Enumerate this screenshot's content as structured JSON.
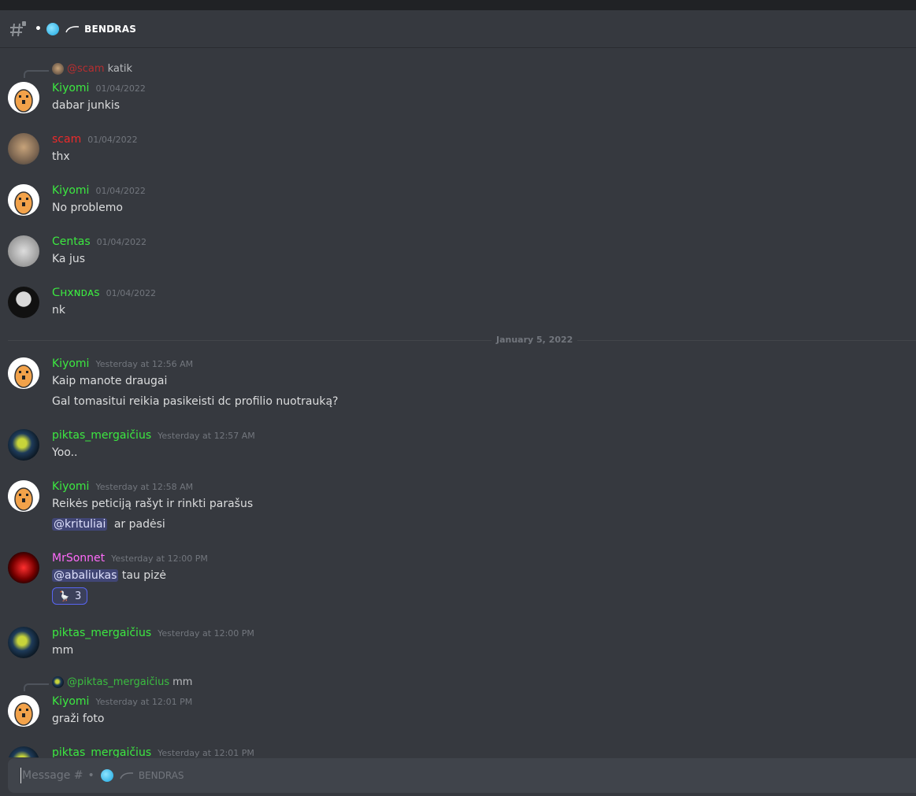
{
  "header": {
    "channel_dot": "•",
    "channel_name": "BENDRAS"
  },
  "colors": {
    "kiyomi": "#3ce840",
    "scam": "#ed2a2a",
    "centas": "#3ce840",
    "chx": "#3ce840",
    "pikt": "#3ce840",
    "mr": "#ff6bfa",
    "mention_bg": "#414675"
  },
  "messages": [
    {
      "reply_mention": "@scam",
      "reply_text": "katik",
      "user": "Kiyomi",
      "time": "01/04/2022",
      "lines": [
        "dabar junkis"
      ]
    },
    {
      "user": "scam",
      "time": "01/04/2022",
      "lines": [
        "thx"
      ]
    },
    {
      "user": "Kiyomi",
      "time": "01/04/2022",
      "lines": [
        "No problemo"
      ]
    },
    {
      "user": "Centas",
      "time": "01/04/2022",
      "lines": [
        "Ka jus"
      ]
    },
    {
      "user": "ᑕʜxɴᴅᴀs",
      "time": "01/04/2022",
      "lines": [
        "nk"
      ]
    },
    {
      "user": "Kiyomi",
      "time": "Yesterday at 12:56 AM",
      "lines": [
        "Kaip manote draugai",
        "Gal tomasitui reikia pasikeisti dc profilio nuotrauką?"
      ]
    },
    {
      "user": "piktas_mergaičius",
      "time": "Yesterday at 12:57 AM",
      "lines": [
        "Yoo.."
      ]
    },
    {
      "user": "Kiyomi",
      "time": "Yesterday at 12:58 AM",
      "lines": [
        "Reikės peticiją rašyt ir rinkti parašus"
      ],
      "mention": "@krituliai",
      "after_mention": "ar padėsi"
    },
    {
      "user": "MrSonnet",
      "time": "Yesterday at 12:00 PM",
      "mention": "@abaliukas",
      "after_mention": "tau pizė",
      "reaction_emoji": "🪿",
      "reaction_count": "3"
    },
    {
      "user": "piktas_mergaičius",
      "time": "Yesterday at 12:00 PM",
      "lines": [
        "mm"
      ]
    },
    {
      "reply_mention": "@piktas_mergaičius",
      "reply_text": "mm",
      "user": "Kiyomi",
      "time": "Yesterday at 12:01 PM",
      "lines": [
        "graži foto"
      ]
    },
    {
      "user": "piktas_mergaičius",
      "time": "Yesterday at 12:01 PM"
    }
  ],
  "divider": {
    "label": "January 5, 2022"
  },
  "composer": {
    "placeholder_prefix": "Message #",
    "dot": "•",
    "channel": "BENDRAS"
  }
}
